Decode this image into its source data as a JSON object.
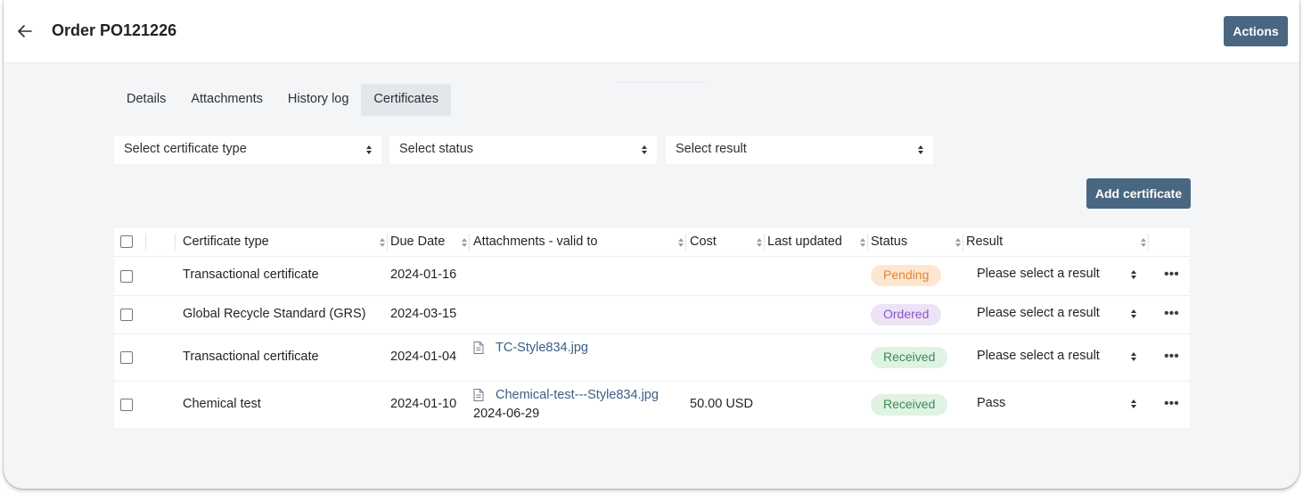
{
  "header": {
    "title": "Order PO121226",
    "actions_label": "Actions"
  },
  "tabs": [
    {
      "label": "Details"
    },
    {
      "label": "Attachments"
    },
    {
      "label": "History log"
    },
    {
      "label": "Certificates",
      "active": true
    }
  ],
  "filters": {
    "certificate_type": "Select certificate type",
    "status": "Select status",
    "result": "Select result"
  },
  "add_certificate_label": "Add certificate",
  "table": {
    "columns": [
      "Certificate type",
      "Due Date",
      "Attachments - valid to",
      "Cost",
      "Last updated",
      "Status",
      "Result"
    ],
    "rows": [
      {
        "type": "Transactional certificate",
        "due": "2024-01-16",
        "attachment": "",
        "valid_to": "",
        "cost": "",
        "updated": "",
        "status": "Pending",
        "status_kind": "pending",
        "result": "Please select a result"
      },
      {
        "type": "Global Recycle Standard (GRS)",
        "due": "2024-03-15",
        "attachment": "",
        "valid_to": "",
        "cost": "",
        "updated": "",
        "status": "Ordered",
        "status_kind": "ordered",
        "result": "Please select a result"
      },
      {
        "type": "Transactional certificate",
        "due": "2024-01-04",
        "attachment": "TC-Style834.jpg",
        "valid_to": "",
        "cost": "",
        "updated": "",
        "status": "Received",
        "status_kind": "received",
        "result": "Please select a result"
      },
      {
        "type": "Chemical test",
        "due": "2024-01-10",
        "attachment": "Chemical-test---Style834.jpg",
        "valid_to": "2024-06-29",
        "cost": "50.00 USD",
        "updated": "",
        "status": "Received",
        "status_kind": "received",
        "result": "Pass"
      }
    ]
  },
  "icons": {
    "back": "arrow-left-icon",
    "more": "more-horizontal-icon",
    "file": "file-icon"
  },
  "colors": {
    "primary_button": "#4a6781",
    "pending": "#e8832e",
    "ordered": "#8a55c8",
    "received": "#3f8a55",
    "link": "#3b5f84"
  }
}
